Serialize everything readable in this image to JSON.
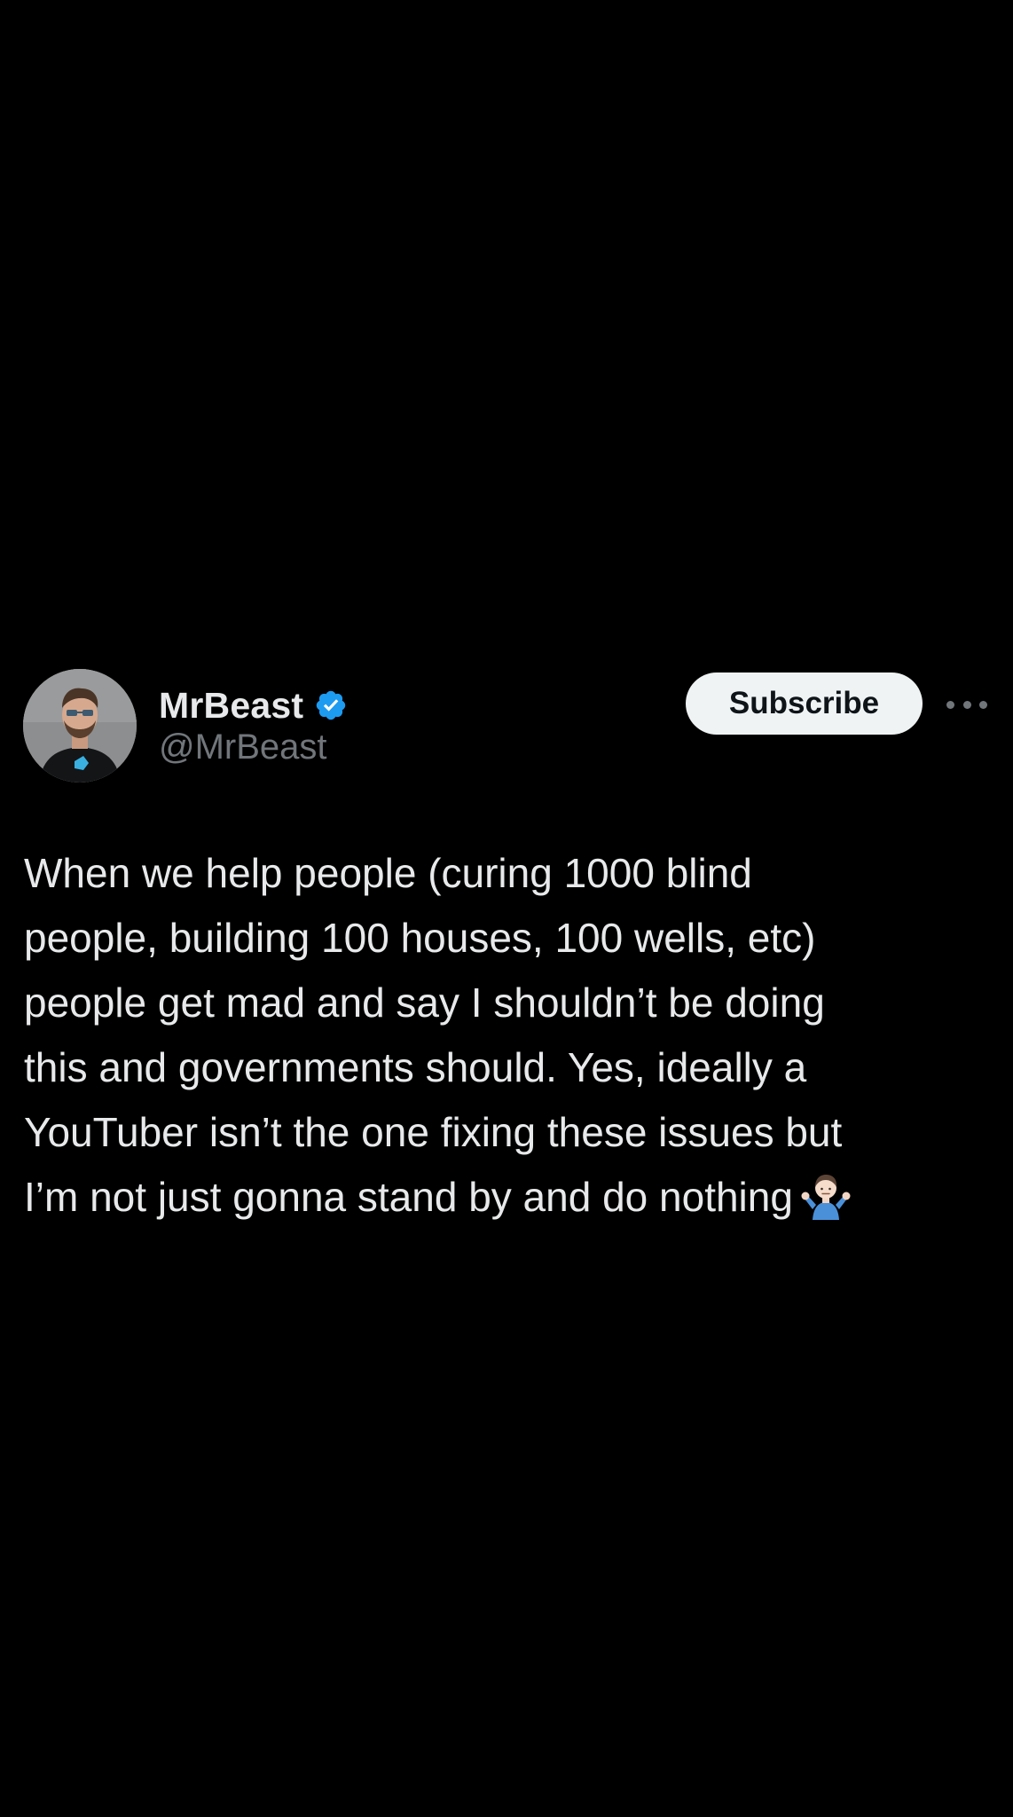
{
  "author": {
    "display_name": "MrBeast",
    "handle": "@MrBeast",
    "verified": true,
    "verified_color": "#1d9bf0",
    "avatar_icon": "avatar-photo"
  },
  "actions": {
    "subscribe_label": "Subscribe",
    "more_icon": "ellipsis-icon"
  },
  "post": {
    "lines": [
      "When we help people (curing 1000 blind",
      "people, building 100 houses, 100 wells, etc)",
      "people get mad and say I shouldn’t be doing",
      "this and governments should. Yes, ideally a",
      "YouTuber isn’t the one fixing these issues but",
      "I’m not just gonna stand by and do nothing"
    ],
    "trailing_emoji": "person-shrugging-emoji"
  },
  "colors": {
    "background": "#000000",
    "primary_text": "#e7e9ea",
    "secondary_text": "#71767b",
    "button_bg": "#eff3f4",
    "button_text": "#0f1419"
  }
}
